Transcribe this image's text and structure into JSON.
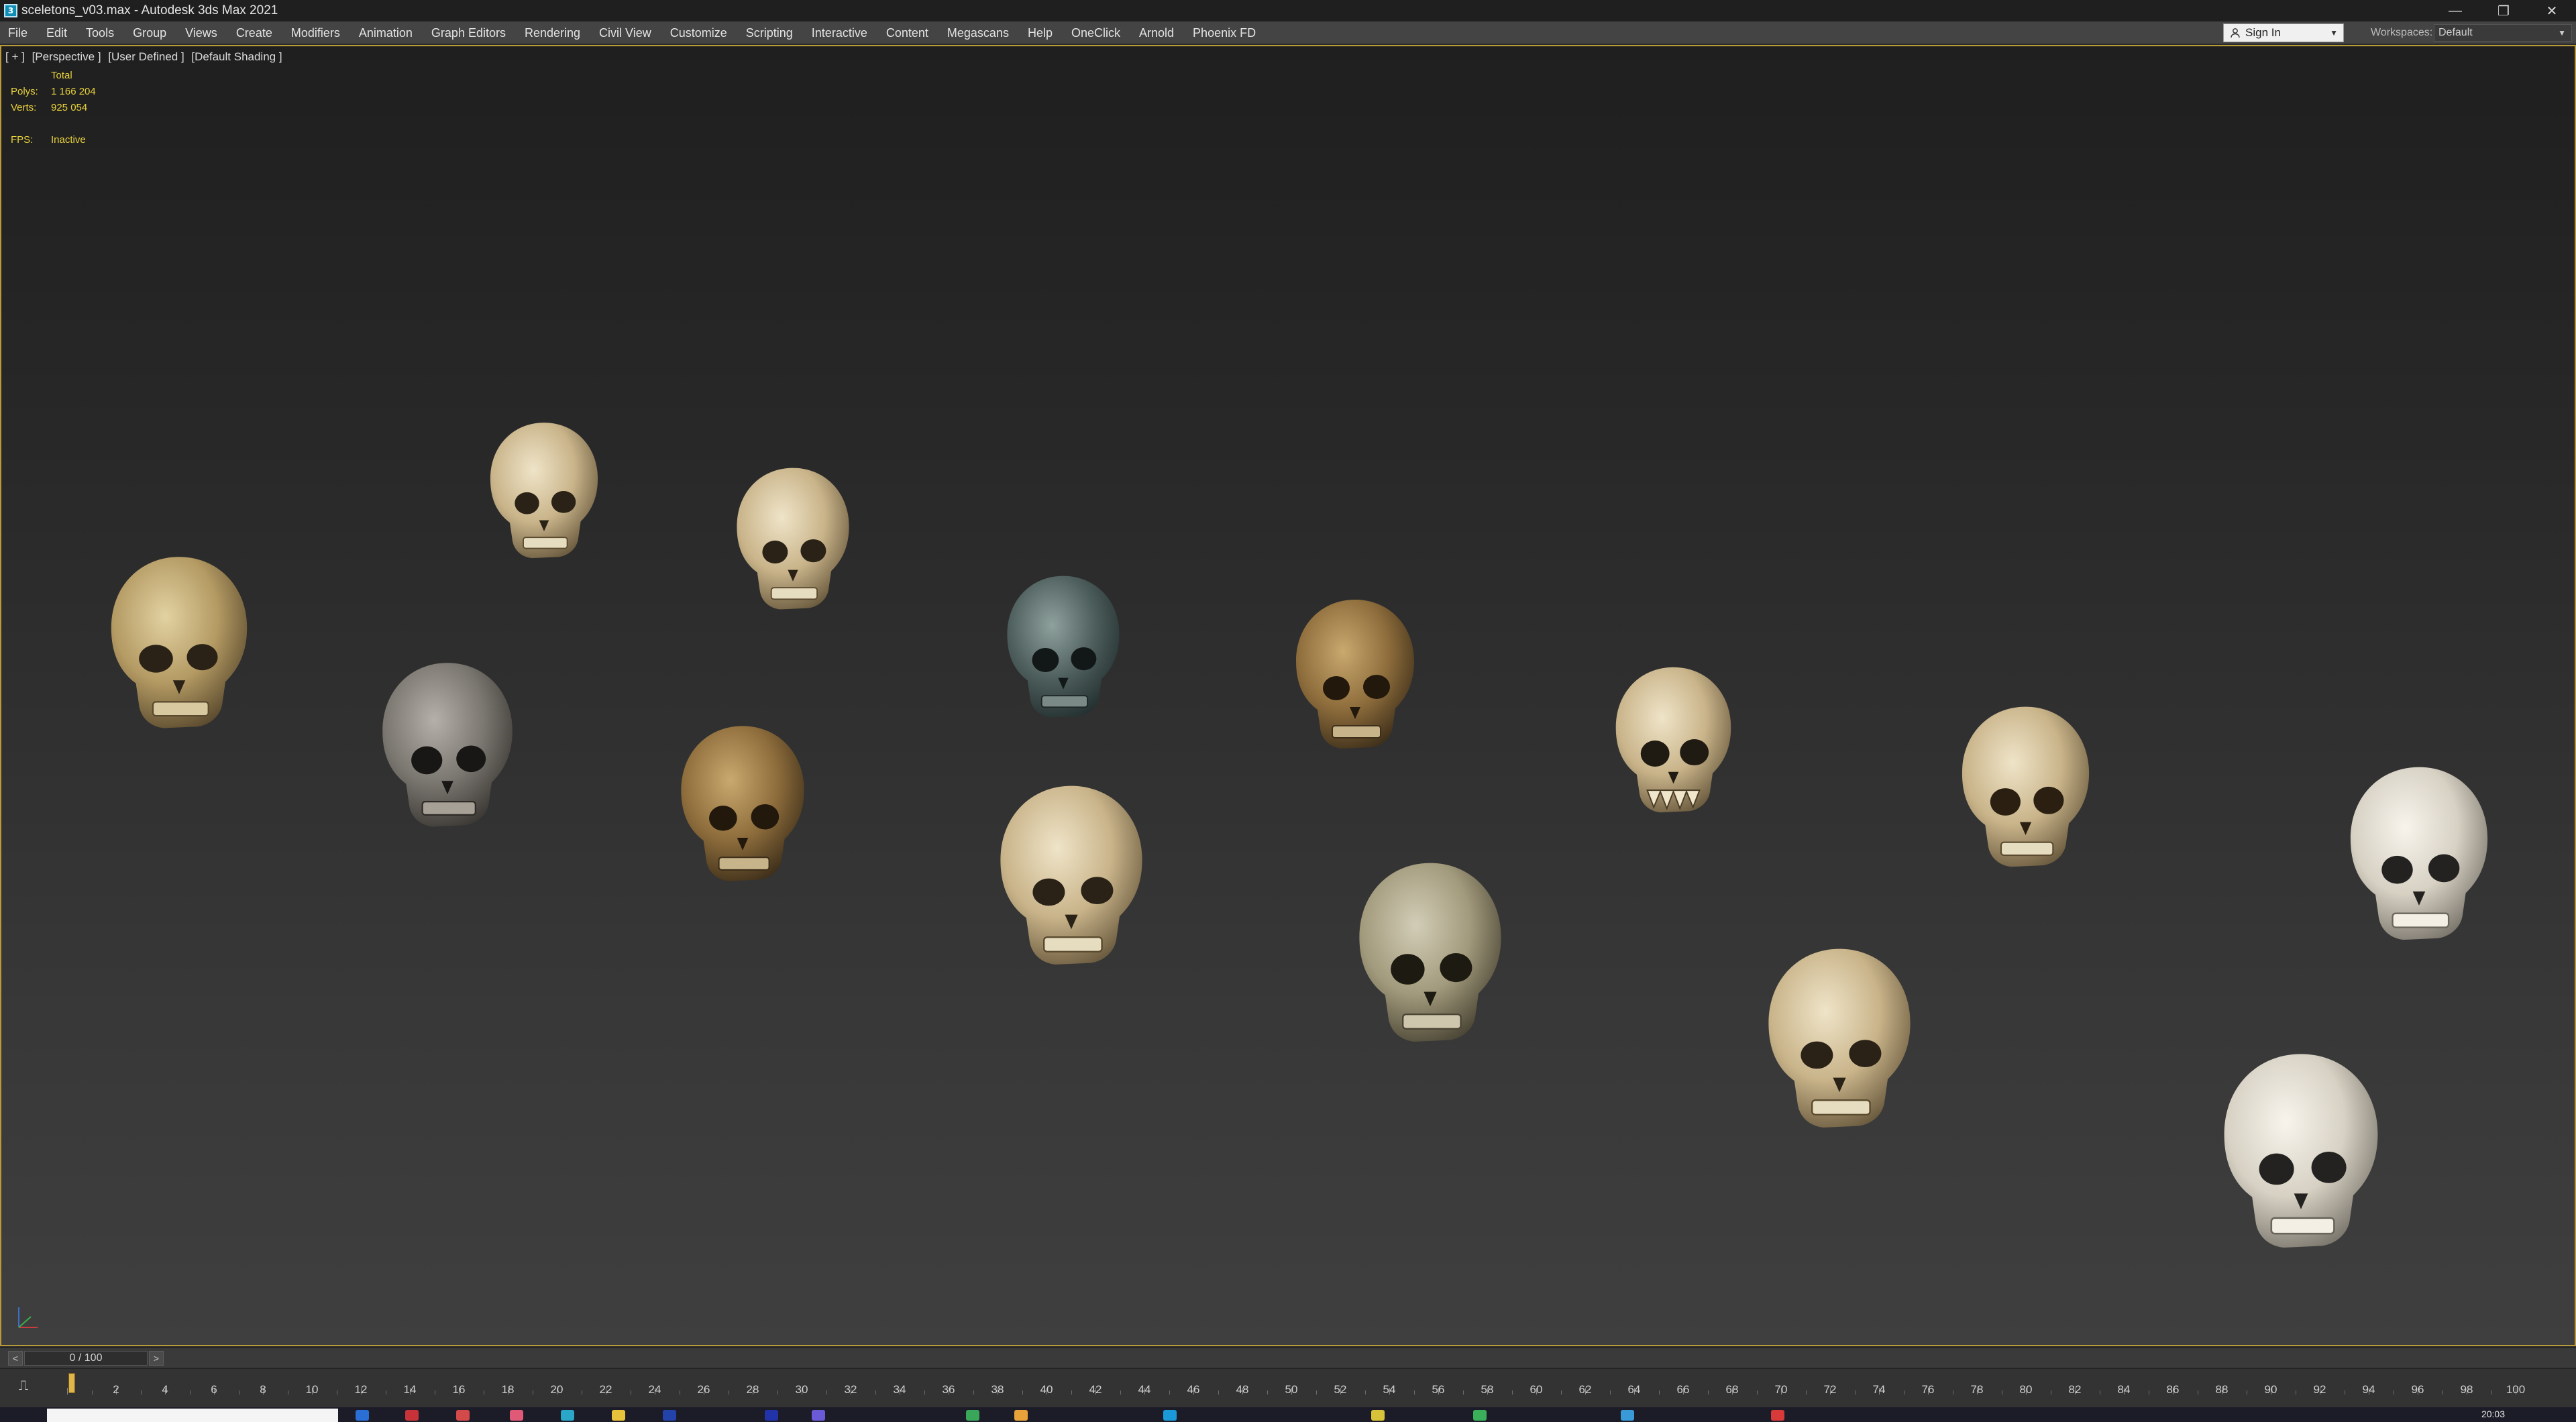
{
  "window": {
    "title": "sceletons_v03.max - Autodesk 3ds Max 2021",
    "app_icon_letter": "3",
    "controls": {
      "minimize": "—",
      "restore": "❐",
      "close": "✕"
    }
  },
  "menu": {
    "items": [
      "File",
      "Edit",
      "Tools",
      "Group",
      "Views",
      "Create",
      "Modifiers",
      "Animation",
      "Graph Editors",
      "Rendering",
      "Civil View",
      "Customize",
      "Scripting",
      "Interactive",
      "Content",
      "Megascans",
      "Help",
      "OneClick",
      "Arnold",
      "Phoenix FD"
    ],
    "sign_in": "Sign In",
    "workspaces_label": "Workspaces:",
    "workspace_value": "Default"
  },
  "viewport": {
    "labels": [
      "[ + ]",
      "[Perspective ]",
      "[User Defined ]",
      "[Default Shading ]"
    ],
    "stats": {
      "header": "Total",
      "polys_label": "Polys:",
      "polys_value": "1 166 204",
      "verts_label": "Verts:",
      "verts_value": "925 054",
      "fps_label": "FPS:",
      "fps_value": "Inactive"
    },
    "border_color": "#b89a3a",
    "stats_color": "#e8d23c"
  },
  "time_slider": {
    "frame_display": "0 / 100",
    "prev": "<",
    "next": ">"
  },
  "trackbar": {
    "icon": "⎍",
    "tick_labels": [
      "2",
      "4",
      "6",
      "8",
      "10",
      "12",
      "14",
      "16",
      "18",
      "20",
      "22",
      "24",
      "26",
      "28",
      "30",
      "32",
      "34",
      "36",
      "38",
      "40",
      "42",
      "44",
      "46",
      "48",
      "50",
      "52",
      "54",
      "56",
      "58",
      "60",
      "62",
      "64",
      "66",
      "68",
      "70",
      "72",
      "74",
      "76",
      "78",
      "80",
      "82",
      "84",
      "86",
      "88",
      "90",
      "92",
      "94",
      "96",
      "98",
      "100"
    ]
  },
  "taskbar": {
    "clock": "20:03"
  }
}
